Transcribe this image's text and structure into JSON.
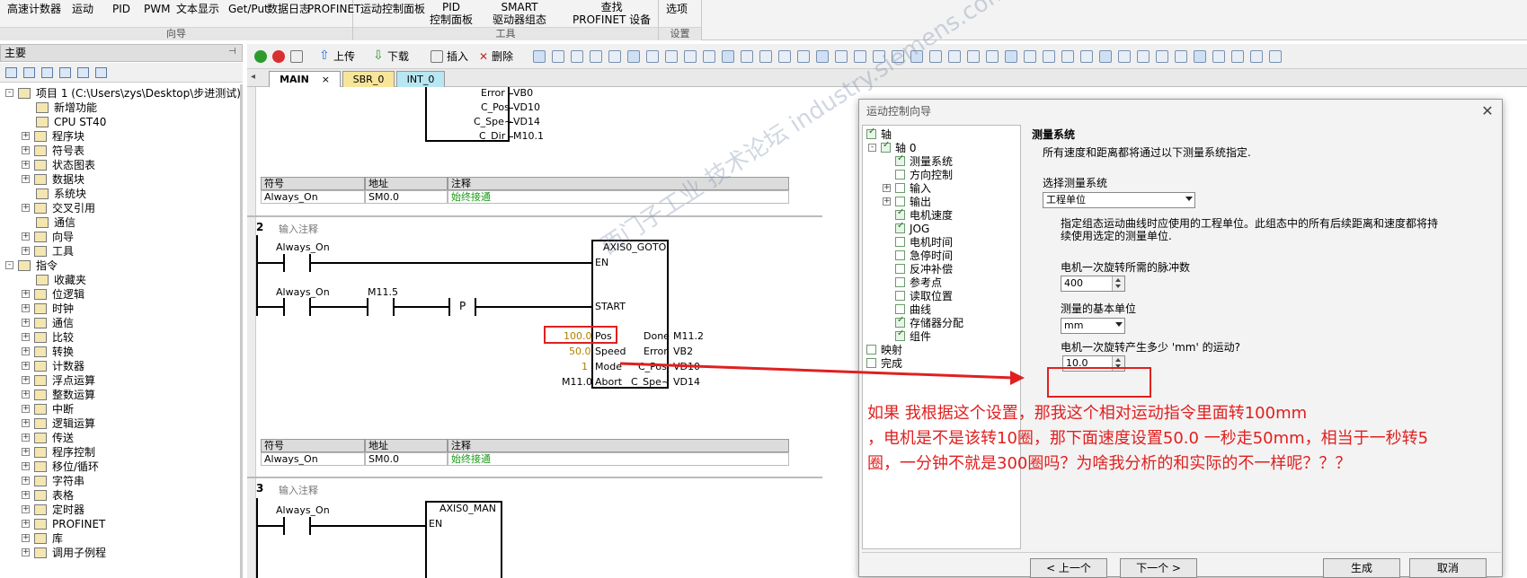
{
  "ribbon": {
    "wizard": {
      "items": [
        "高速计数器",
        "运动",
        "PID",
        "PWM",
        "文本显示",
        "Get/Put",
        "数据日志",
        "PROFINET"
      ],
      "caption": "向导"
    },
    "tools": {
      "items": [
        "运动控制面板",
        "PID\n控制面板",
        "SMART\n驱动器组态",
        "查找\nPROFINET 设备"
      ],
      "caption": "工具"
    },
    "settings": {
      "items": [
        "选项"
      ],
      "caption": "设置"
    }
  },
  "left": {
    "title": "主要",
    "tree": [
      {
        "label": "项目 1 (C:\\Users\\zys\\Desktop\\步进测试)",
        "lvl": 0,
        "exp": "-"
      },
      {
        "label": "新增功能",
        "lvl": 2,
        "exp": ""
      },
      {
        "label": "CPU ST40",
        "lvl": 2,
        "exp": ""
      },
      {
        "label": "程序块",
        "lvl": 1,
        "exp": "+"
      },
      {
        "label": "符号表",
        "lvl": 1,
        "exp": "+"
      },
      {
        "label": "状态图表",
        "lvl": 1,
        "exp": "+"
      },
      {
        "label": "数据块",
        "lvl": 1,
        "exp": "+"
      },
      {
        "label": "系统块",
        "lvl": 2,
        "exp": ""
      },
      {
        "label": "交叉引用",
        "lvl": 1,
        "exp": "+"
      },
      {
        "label": "通信",
        "lvl": 2,
        "exp": ""
      },
      {
        "label": "向导",
        "lvl": 1,
        "exp": "+"
      },
      {
        "label": "工具",
        "lvl": 1,
        "exp": "+"
      },
      {
        "label": "指令",
        "lvl": 0,
        "exp": "-"
      },
      {
        "label": "收藏夹",
        "lvl": 2,
        "exp": ""
      },
      {
        "label": "位逻辑",
        "lvl": 1,
        "exp": "+"
      },
      {
        "label": "时钟",
        "lvl": 1,
        "exp": "+"
      },
      {
        "label": "通信",
        "lvl": 1,
        "exp": "+"
      },
      {
        "label": "比较",
        "lvl": 1,
        "exp": "+"
      },
      {
        "label": "转换",
        "lvl": 1,
        "exp": "+"
      },
      {
        "label": "计数器",
        "lvl": 1,
        "exp": "+"
      },
      {
        "label": "浮点运算",
        "lvl": 1,
        "exp": "+"
      },
      {
        "label": "整数运算",
        "lvl": 1,
        "exp": "+"
      },
      {
        "label": "中断",
        "lvl": 1,
        "exp": "+"
      },
      {
        "label": "逻辑运算",
        "lvl": 1,
        "exp": "+"
      },
      {
        "label": "传送",
        "lvl": 1,
        "exp": "+"
      },
      {
        "label": "程序控制",
        "lvl": 1,
        "exp": "+"
      },
      {
        "label": "移位/循环",
        "lvl": 1,
        "exp": "+"
      },
      {
        "label": "字符串",
        "lvl": 1,
        "exp": "+"
      },
      {
        "label": "表格",
        "lvl": 1,
        "exp": "+"
      },
      {
        "label": "定时器",
        "lvl": 1,
        "exp": "+"
      },
      {
        "label": "PROFINET",
        "lvl": 1,
        "exp": "+"
      },
      {
        "label": "库",
        "lvl": 1,
        "exp": "+"
      },
      {
        "label": "调用子例程",
        "lvl": 1,
        "exp": "+"
      }
    ]
  },
  "toolbar": {
    "upload": "上传",
    "download": "下载",
    "insert": "插入",
    "delete": "删除"
  },
  "tabs": [
    {
      "label": "MAIN",
      "close": "×"
    },
    {
      "label": "SBR_0"
    },
    {
      "label": "INT_0"
    }
  ],
  "editor": {
    "net1": {
      "pins": [
        "Error",
        "C_Pos",
        "C_Spe~",
        "C_Dir"
      ],
      "vals": [
        "VB0",
        "VD10",
        "VD14",
        "M10.1"
      ]
    },
    "symtable": {
      "headers": [
        "符号",
        "地址",
        "注释"
      ],
      "row": [
        "Always_On",
        "SM0.0",
        "始终接通"
      ]
    },
    "net2": {
      "num": "2",
      "comment": "输入注释",
      "contact1": "Always_On",
      "contact2": "Always_On",
      "contact3": "M11.5",
      "pcontact": "P",
      "block": "AXIS0_GOTO",
      "en": "EN",
      "start": "START",
      "inputs": [
        {
          "val": "100.0",
          "pin": "Pos"
        },
        {
          "val": "50.0",
          "pin": "Speed"
        },
        {
          "val": "1",
          "pin": "Mode"
        },
        {
          "val": "M11.0",
          "pin": "Abort"
        }
      ],
      "outputs": [
        {
          "pin": "Done",
          "val": "M11.2"
        },
        {
          "pin": "Error",
          "val": "VB2"
        },
        {
          "pin": "C_Pos",
          "val": "VD10"
        },
        {
          "pin": "C_Spe~",
          "val": "VD14"
        }
      ]
    },
    "net3": {
      "num": "3",
      "comment": "输入注释",
      "contact1": "Always_On",
      "block": "AXIS0_MAN",
      "en": "EN"
    }
  },
  "dialog": {
    "title": "运动控制向导",
    "close": "✕",
    "tree": [
      {
        "label": "轴",
        "lvl": 0,
        "chk": true,
        "exp": ""
      },
      {
        "label": "轴 0",
        "lvl": 1,
        "chk": true,
        "exp": "-"
      },
      {
        "label": "测量系统",
        "lvl": 2,
        "chk": true,
        "exp": ""
      },
      {
        "label": "方向控制",
        "lvl": 2,
        "chk": false,
        "exp": ""
      },
      {
        "label": "输入",
        "lvl": 2,
        "chk": false,
        "exp": "+"
      },
      {
        "label": "输出",
        "lvl": 2,
        "chk": false,
        "exp": "+"
      },
      {
        "label": "电机速度",
        "lvl": 2,
        "chk": true,
        "exp": ""
      },
      {
        "label": "JOG",
        "lvl": 2,
        "chk": true,
        "exp": ""
      },
      {
        "label": "电机时间",
        "lvl": 2,
        "chk": false,
        "exp": ""
      },
      {
        "label": "急停时间",
        "lvl": 2,
        "chk": false,
        "exp": ""
      },
      {
        "label": "反冲补偿",
        "lvl": 2,
        "chk": false,
        "exp": ""
      },
      {
        "label": "参考点",
        "lvl": 2,
        "chk": false,
        "exp": ""
      },
      {
        "label": "读取位置",
        "lvl": 2,
        "chk": false,
        "exp": ""
      },
      {
        "label": "曲线",
        "lvl": 2,
        "chk": false,
        "exp": ""
      },
      {
        "label": "存储器分配",
        "lvl": 2,
        "chk": true,
        "exp": ""
      },
      {
        "label": "组件",
        "lvl": 2,
        "chk": true,
        "exp": ""
      },
      {
        "label": "映射",
        "lvl": 0,
        "chk": false,
        "exp": ""
      },
      {
        "label": "完成",
        "lvl": 0,
        "chk": false,
        "exp": ""
      }
    ],
    "section_title": "测量系统",
    "section_desc": "所有速度和距离都将通过以下测量系统指定.",
    "select_label": "选择测量系统",
    "select_value": "工程单位",
    "info_line1": "指定组态运动曲线时应使用的工程单位。此组态中的所有后续距离和速度都将持",
    "info_line2": "续使用选定的测量单位.",
    "pulses_label": "电机一次旋转所需的脉冲数",
    "pulses_value": "400",
    "unit_label": "测量的基本单位",
    "unit_value": "mm",
    "travel_label": "电机一次旋转产生多少 'mm' 的运动?",
    "travel_value": "10.0",
    "buttons": {
      "prev": "< 上一个",
      "next": "下一个 >",
      "generate": "生成",
      "cancel": "取消"
    }
  },
  "annotation": {
    "line1": "如果 我根据这个设置，那我这个相对运动指令里面转100mm",
    "line2": "，电机是不是该转10圈，那下面速度设置50.0   一秒走50mm，相当于一秒转5",
    "line3": "圈，一分钟不就是300圈吗？为啥我分析的和实际的不一样呢？？？",
    "color": "#e02020"
  },
  "watermark": "西门子工业  技术论坛  industry.siemens.com"
}
